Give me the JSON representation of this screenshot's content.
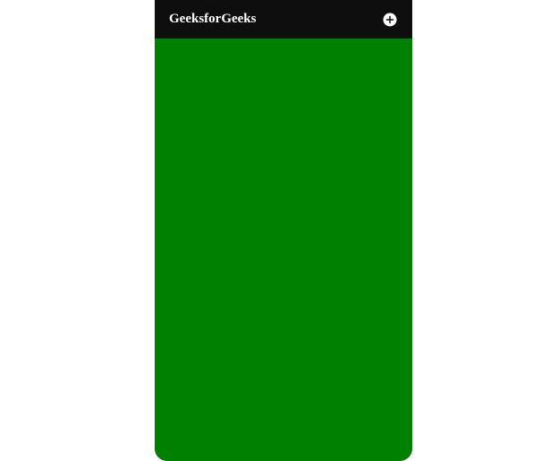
{
  "appbar": {
    "title": "GeeksforGeeks",
    "action_icon": "plus-circle-icon"
  },
  "theme": {
    "appbar_bg": "#0e0e0e",
    "body_bg": "#008000",
    "title_color": "#ffffff"
  }
}
